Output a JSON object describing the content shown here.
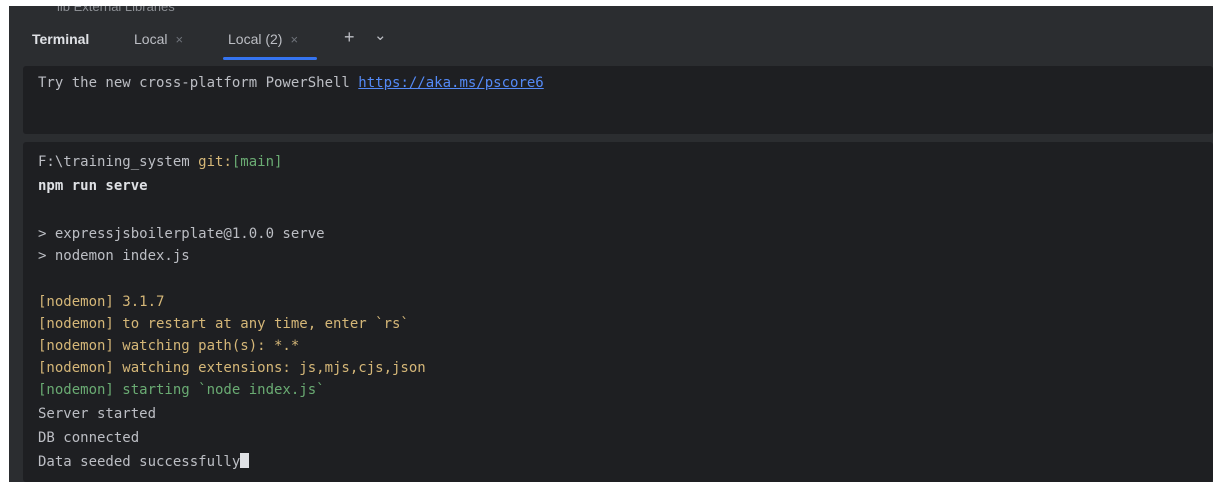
{
  "background_peek": {
    "text": "lib External Libraries"
  },
  "tabbar": {
    "title": "Terminal",
    "tabs": [
      {
        "label": "Local",
        "close": "×",
        "active": false
      },
      {
        "label": "Local (2)",
        "close": "×",
        "active": true
      }
    ],
    "new_tab_label": "+",
    "dropdown_label": "⌄"
  },
  "pane_top": {
    "text": "Try the new cross-platform PowerShell ",
    "link": "https://aka.ms/pscore6"
  },
  "pane_main": {
    "prompt_path": "F:\\training_system ",
    "prompt_git": "git:",
    "prompt_branch": "[main]",
    "command": "npm run serve",
    "output_1": "> expressjsboilerplate@1.0.0 serve",
    "output_2": "> nodemon index.js",
    "nodemon_1": "[nodemon] 3.1.7",
    "nodemon_2": "[nodemon] to restart at any time, enter `rs`",
    "nodemon_3": "[nodemon] watching path(s): *.*",
    "nodemon_4": "[nodemon] watching extensions: js,mjs,cjs,json",
    "nodemon_5": "[nodemon] starting `node index.js`",
    "log_1": "Server started",
    "log_2": "DB connected",
    "log_3": "Data seeded successfully"
  },
  "colors": {
    "accent": "#3574f0",
    "link": "#548af7",
    "nodemon_yellow": "#d5b778",
    "nodemon_green": "#6aab73",
    "terminal_bg": "#1e1f22",
    "chrome_bg": "#2b2d30"
  }
}
